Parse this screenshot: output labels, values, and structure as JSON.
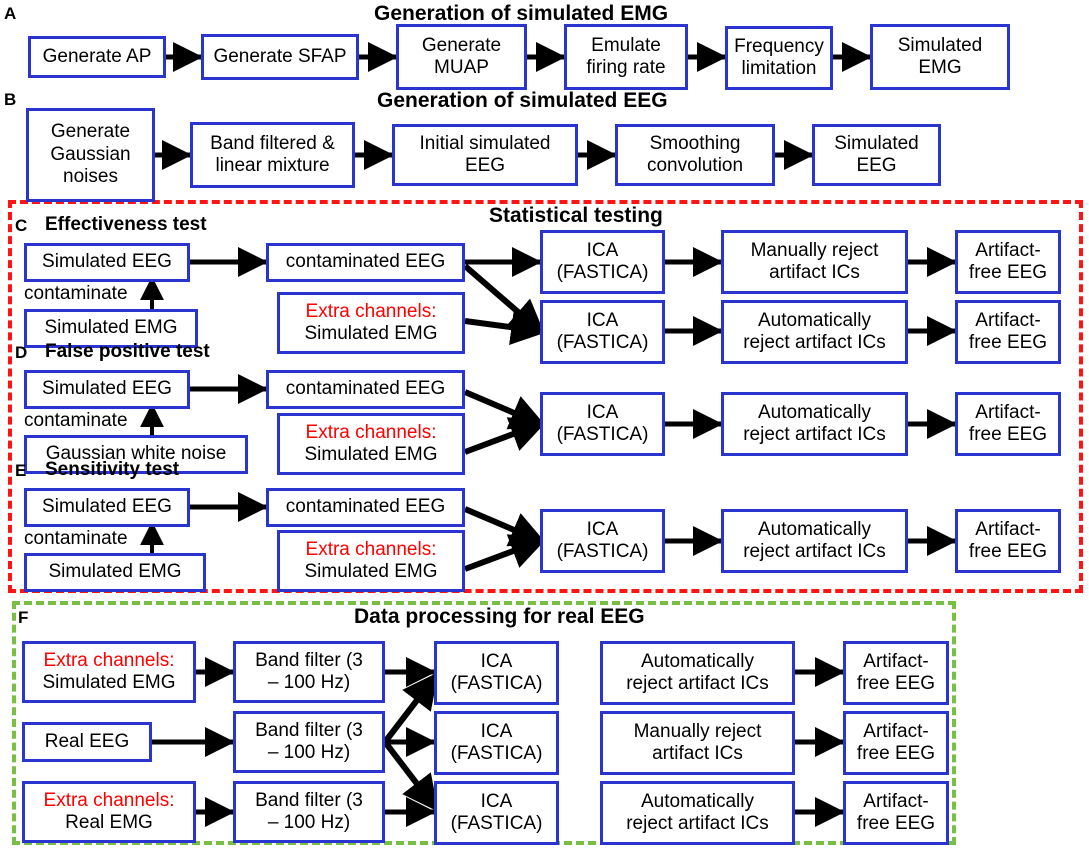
{
  "figure": {
    "panels": [
      {
        "letter": "A",
        "title": "Generation of simulated EMG"
      },
      {
        "letter": "B",
        "title": "Generation of simulated EEG"
      },
      {
        "letter": "C",
        "subtitle": "Effectiveness test"
      },
      {
        "letter": "D",
        "subtitle": "False positive test"
      },
      {
        "letter": "E",
        "subtitle": "Sensitivity test"
      },
      {
        "letter": "F",
        "title": "Data processing for real EEG"
      }
    ],
    "group_titles": {
      "statistical": "Statistical testing",
      "real_eeg": "Data processing for real EEG"
    },
    "colors": {
      "node_border": "#2a35cf",
      "red_group_border": "#ff1414",
      "green_group_border": "#77c043",
      "highlight_text": "#ff0000",
      "arrow": "#000000",
      "background": "#ffffff"
    }
  },
  "panel_a": {
    "letter": "A",
    "title": "Generation of simulated EMG",
    "nodes": [
      {
        "id": "a1",
        "lines": [
          "Generate AP"
        ]
      },
      {
        "id": "a2",
        "lines": [
          "Generate SFAP"
        ]
      },
      {
        "id": "a3",
        "lines": [
          "Generate",
          "MUAP"
        ]
      },
      {
        "id": "a4",
        "lines": [
          "Emulate",
          "firing rate"
        ]
      },
      {
        "id": "a5",
        "lines": [
          "Frequency",
          "limitation"
        ]
      },
      {
        "id": "a6",
        "lines": [
          "Simulated",
          "EMG"
        ]
      }
    ]
  },
  "panel_b": {
    "letter": "B",
    "title": "Generation of simulated EEG",
    "nodes": [
      {
        "id": "b1",
        "lines": [
          "Generate",
          "Gaussian",
          "noises"
        ]
      },
      {
        "id": "b2",
        "lines": [
          "Band filtered &",
          "linear mixture"
        ]
      },
      {
        "id": "b3",
        "lines": [
          "Initial simulated",
          "EEG"
        ]
      },
      {
        "id": "b4",
        "lines": [
          "Smoothing",
          "convolution"
        ]
      },
      {
        "id": "b5",
        "lines": [
          "Simulated",
          "EEG"
        ]
      }
    ]
  },
  "panel_c": {
    "letter": "C",
    "subtitle": "Effectiveness test",
    "contaminate_label": "contaminate",
    "nodes": [
      {
        "id": "c1",
        "lines": [
          "Simulated EEG"
        ]
      },
      {
        "id": "c2",
        "lines": [
          "Simulated EMG"
        ]
      },
      {
        "id": "c3",
        "lines": [
          "contaminated EEG"
        ]
      },
      {
        "id": "c4",
        "lines": [
          "Extra channels:",
          "Simulated EMG"
        ],
        "red_first_line": true
      },
      {
        "id": "c5",
        "lines": [
          "ICA",
          "(FASTICA)"
        ]
      },
      {
        "id": "c6",
        "lines": [
          "ICA",
          "(FASTICA)"
        ]
      },
      {
        "id": "c7",
        "lines": [
          "Manually reject",
          "artifact ICs"
        ]
      },
      {
        "id": "c8",
        "lines": [
          "Automatically",
          "reject artifact ICs"
        ]
      },
      {
        "id": "c9",
        "lines": [
          "Artifact-",
          "free EEG"
        ]
      },
      {
        "id": "c10",
        "lines": [
          "Artifact-",
          "free EEG"
        ]
      }
    ]
  },
  "panel_d": {
    "letter": "D",
    "subtitle": "False positive test",
    "contaminate_label": "contaminate",
    "nodes": [
      {
        "id": "d1",
        "lines": [
          "Simulated EEG"
        ]
      },
      {
        "id": "d2",
        "lines": [
          "Gaussian white noise"
        ]
      },
      {
        "id": "d3",
        "lines": [
          "contaminated EEG"
        ]
      },
      {
        "id": "d4",
        "lines": [
          "Extra channels:",
          "Simulated EMG"
        ],
        "red_first_line": true
      },
      {
        "id": "d5",
        "lines": [
          "ICA",
          "(FASTICA)"
        ]
      },
      {
        "id": "d6",
        "lines": [
          "Automatically",
          "reject artifact ICs"
        ]
      },
      {
        "id": "d7",
        "lines": [
          "Artifact-",
          "free EEG"
        ]
      }
    ]
  },
  "panel_e": {
    "letter": "E",
    "subtitle": "Sensitivity test",
    "contaminate_label": "contaminate",
    "nodes": [
      {
        "id": "e1",
        "lines": [
          "Simulated EEG"
        ]
      },
      {
        "id": "e2",
        "lines": [
          "Simulated EMG"
        ]
      },
      {
        "id": "e3",
        "lines": [
          "contaminated EEG"
        ]
      },
      {
        "id": "e4",
        "lines": [
          "Extra channels:",
          "Simulated EMG"
        ],
        "red_first_line": true
      },
      {
        "id": "e5",
        "lines": [
          "ICA",
          "(FASTICA)"
        ]
      },
      {
        "id": "e6",
        "lines": [
          "Automatically",
          "reject artifact ICs"
        ]
      },
      {
        "id": "e7",
        "lines": [
          "Artifact-",
          "free EEG"
        ]
      }
    ]
  },
  "panel_f": {
    "letter": "F",
    "title": "Data processing for real EEG",
    "nodes": [
      {
        "id": "f1",
        "lines": [
          "Extra channels:",
          "Simulated EMG"
        ],
        "red_first_line": true
      },
      {
        "id": "f2",
        "lines": [
          "Real EEG"
        ]
      },
      {
        "id": "f3",
        "lines": [
          "Extra channels:",
          "Real EMG"
        ],
        "red_first_line": true
      },
      {
        "id": "f4",
        "lines": [
          "Band filter (3",
          "– 100 Hz)"
        ]
      },
      {
        "id": "f5",
        "lines": [
          "Band filter (3",
          "– 100 Hz)"
        ]
      },
      {
        "id": "f6",
        "lines": [
          "Band filter (3",
          "– 100 Hz)"
        ]
      },
      {
        "id": "f7",
        "lines": [
          "ICA",
          "(FASTICA)"
        ]
      },
      {
        "id": "f8",
        "lines": [
          "ICA",
          "(FASTICA)"
        ]
      },
      {
        "id": "f9",
        "lines": [
          "ICA",
          "(FASTICA)"
        ]
      },
      {
        "id": "f10",
        "lines": [
          "Automatically",
          "reject artifact ICs"
        ]
      },
      {
        "id": "f11",
        "lines": [
          "Manually reject",
          "artifact ICs"
        ]
      },
      {
        "id": "f12",
        "lines": [
          "Automatically",
          "reject artifact ICs"
        ]
      },
      {
        "id": "f13",
        "lines": [
          "Artifact-",
          "free EEG"
        ]
      },
      {
        "id": "f14",
        "lines": [
          "Artifact-",
          "free EEG"
        ]
      },
      {
        "id": "f15",
        "lines": [
          "Artifact-",
          "free EEG"
        ]
      }
    ]
  }
}
